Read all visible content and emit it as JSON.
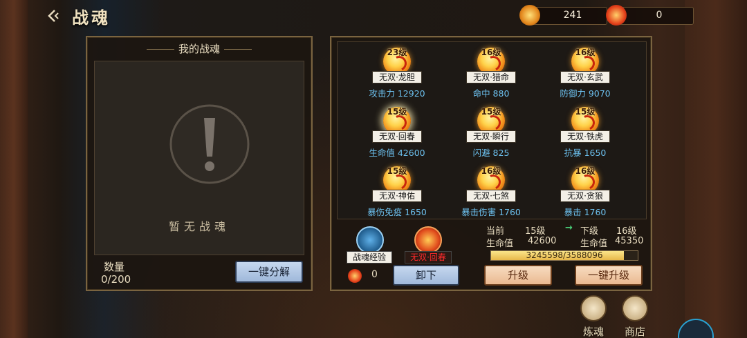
{
  "header": {
    "title": "战魂",
    "currencies": [
      {
        "icon": "fire-crystal-icon",
        "value": "241"
      },
      {
        "icon": "flame-orb-icon",
        "value": "0"
      }
    ]
  },
  "my_souls": {
    "title": "我的战魂",
    "empty_text": "暂无战魂",
    "count_label": "数量",
    "count_value": "0/200",
    "decompose_button": "一键分解"
  },
  "souls": [
    {
      "level": "23级",
      "name": "无双·龙胆",
      "stat": "攻击力 12920"
    },
    {
      "level": "16级",
      "name": "无双·猎命",
      "stat": "命中 880"
    },
    {
      "level": "16级",
      "name": "无双·玄武",
      "stat": "防御力 9070"
    },
    {
      "level": "15级",
      "name": "无双·回春",
      "stat": "生命值 42600"
    },
    {
      "level": "15级",
      "name": "无双·瞬行",
      "stat": "闪避 825"
    },
    {
      "level": "15级",
      "name": "无双·铁虎",
      "stat": "抗暴 1650"
    },
    {
      "level": "15级",
      "name": "无双·神佑",
      "stat": "暴伤免疫 1650"
    },
    {
      "level": "16级",
      "name": "无双·七煞",
      "stat": "暴击伤害 1760"
    },
    {
      "level": "16级",
      "name": "无双·贪狼",
      "stat": "暴击 1760"
    }
  ],
  "detail": {
    "exp_label": "战魂经验",
    "exp_value": "0",
    "selected_label": "无双·回春",
    "unequip_button": "卸下",
    "current_label": "当前",
    "current_level": "15级",
    "next_label": "下级",
    "next_level": "16级",
    "hp_label": "生命值",
    "current_hp": "42600",
    "next_hp": "45350",
    "progress_text": "3245598/3588096",
    "progress_fraction": 0.9045,
    "upgrade_button": "升级",
    "upgrade_all_button": "一键升级"
  },
  "side": {
    "refine_label": "炼魂",
    "shop_label": "商店"
  },
  "colors": {
    "stat_blue": "#6cc0ee",
    "selected_red": "#ff2b2b",
    "gold": "#ffd24a"
  }
}
